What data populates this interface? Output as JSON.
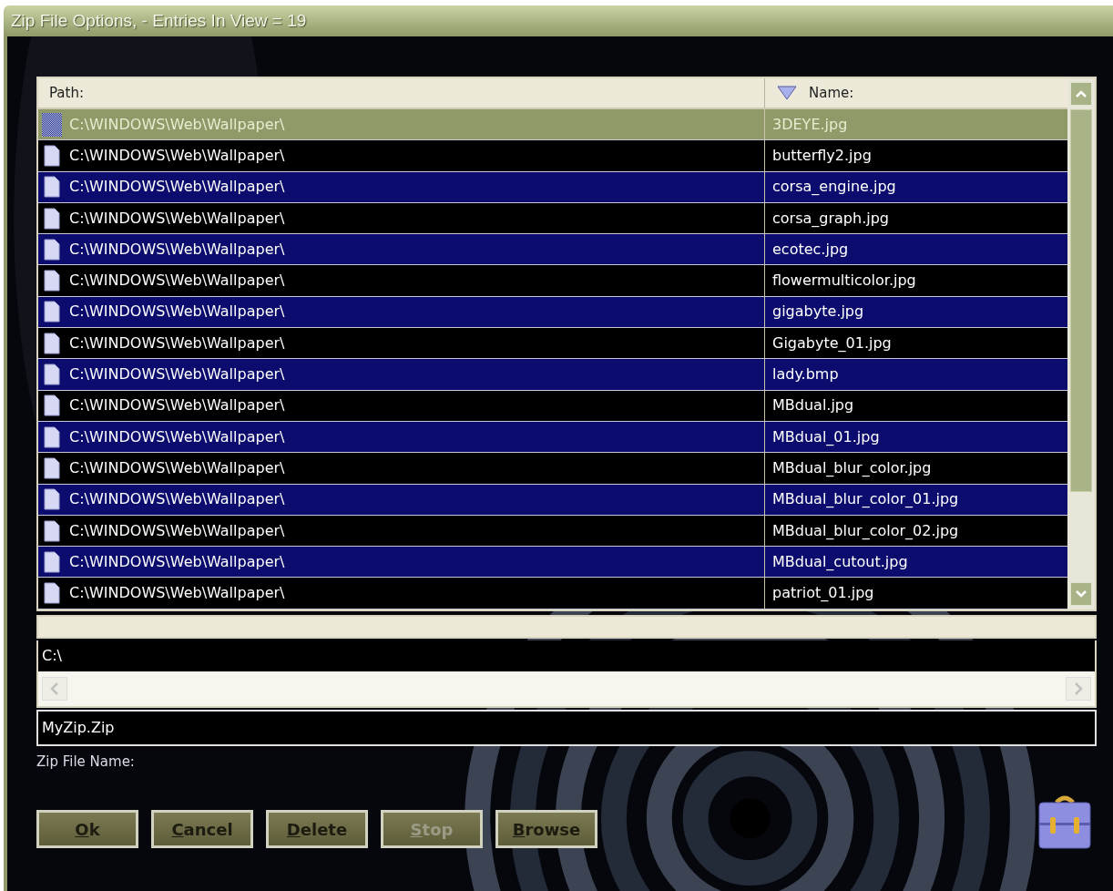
{
  "window": {
    "title": "Zip File Options, - Entries In View = 19"
  },
  "table": {
    "columns": [
      {
        "label": "Path:",
        "sort_icon": false
      },
      {
        "label": "Name:",
        "sort_icon": true
      }
    ],
    "rows": [
      {
        "path": "C:\\WINDOWS\\Web\\Wallpaper\\",
        "name": "3DEYE.jpg",
        "selected": true
      },
      {
        "path": "C:\\WINDOWS\\Web\\Wallpaper\\",
        "name": "butterfly2.jpg",
        "selected": false
      },
      {
        "path": "C:\\WINDOWS\\Web\\Wallpaper\\",
        "name": "corsa_engine.jpg",
        "selected": false
      },
      {
        "path": "C:\\WINDOWS\\Web\\Wallpaper\\",
        "name": "corsa_graph.jpg",
        "selected": false
      },
      {
        "path": "C:\\WINDOWS\\Web\\Wallpaper\\",
        "name": "ecotec.jpg",
        "selected": false
      },
      {
        "path": "C:\\WINDOWS\\Web\\Wallpaper\\",
        "name": "flowermulticolor.jpg",
        "selected": false
      },
      {
        "path": "C:\\WINDOWS\\Web\\Wallpaper\\",
        "name": "gigabyte.jpg",
        "selected": false
      },
      {
        "path": "C:\\WINDOWS\\Web\\Wallpaper\\",
        "name": "Gigabyte_01.jpg",
        "selected": false
      },
      {
        "path": "C:\\WINDOWS\\Web\\Wallpaper\\",
        "name": "lady.bmp",
        "selected": false
      },
      {
        "path": "C:\\WINDOWS\\Web\\Wallpaper\\",
        "name": "MBdual.jpg",
        "selected": false
      },
      {
        "path": "C:\\WINDOWS\\Web\\Wallpaper\\",
        "name": "MBdual_01.jpg",
        "selected": false
      },
      {
        "path": "C:\\WINDOWS\\Web\\Wallpaper\\",
        "name": "MBdual_blur_color.jpg",
        "selected": false
      },
      {
        "path": "C:\\WINDOWS\\Web\\Wallpaper\\",
        "name": "MBdual_blur_color_01.jpg",
        "selected": false
      },
      {
        "path": "C:\\WINDOWS\\Web\\Wallpaper\\",
        "name": "MBdual_blur_color_02.jpg",
        "selected": false
      },
      {
        "path": "C:\\WINDOWS\\Web\\Wallpaper\\",
        "name": "MBdual_cutout.jpg",
        "selected": false
      },
      {
        "path": "C:\\WINDOWS\\Web\\Wallpaper\\",
        "name": "patriot_01.jpg",
        "selected": false
      }
    ]
  },
  "folder_field": {
    "value": "C:\\"
  },
  "zip_name_field": {
    "value": "MyZip.Zip",
    "label": "Zip File Name:"
  },
  "buttons": [
    {
      "label": "Ok",
      "disabled": false
    },
    {
      "label": "Cancel",
      "disabled": false
    },
    {
      "label": "Delete",
      "disabled": false
    },
    {
      "label": "Stop",
      "disabled": true
    },
    {
      "label": "Browse",
      "disabled": false
    }
  ]
}
